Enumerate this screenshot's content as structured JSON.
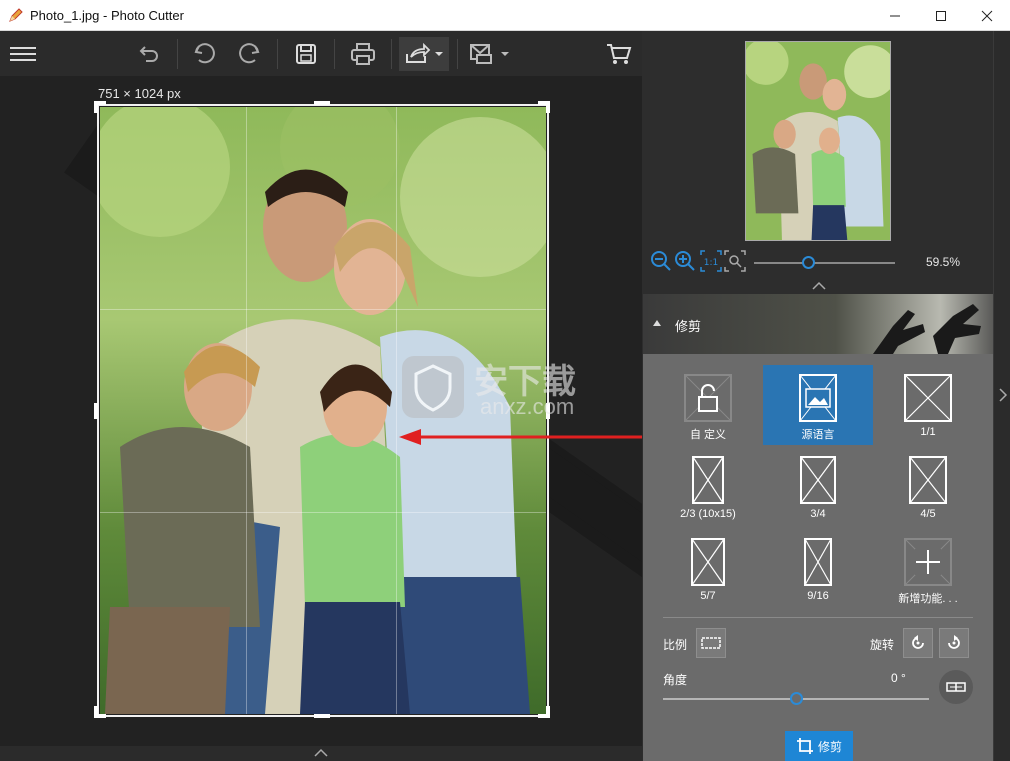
{
  "window": {
    "title": "Photo_1.jpg - Photo Cutter",
    "minimize_glyph": "—",
    "maximize_glyph": "☐",
    "close_glyph": "✕"
  },
  "toolbar": {
    "items": [
      "menu-icon",
      "undo-arrow-icon",
      "undo-icon",
      "redo-icon",
      "save-icon",
      "print-icon",
      "share-icon",
      "send-icon",
      "cart-icon"
    ]
  },
  "canvas": {
    "dimensions_label": "751 × 1024 px"
  },
  "zoom": {
    "value": "59.5%",
    "level": 0.38
  },
  "section": {
    "title": "修剪"
  },
  "crop": {
    "ratios": [
      {
        "label": "自 定义",
        "selected": false
      },
      {
        "label": "源语言",
        "selected": true
      },
      {
        "label": "1/1",
        "selected": false
      },
      {
        "label": "2/3 (10x15)",
        "selected": false
      },
      {
        "label": "3/4",
        "selected": false
      },
      {
        "label": "4/5",
        "selected": false
      },
      {
        "label": "5/7",
        "selected": false
      },
      {
        "label": "9/16",
        "selected": false
      },
      {
        "label": "新增功能. . .",
        "selected": false
      }
    ],
    "ratio_label": "比例",
    "rotate_label": "旋转",
    "angle_label": "角度",
    "angle_value": "0 °",
    "angle_level": 0.5,
    "action_label": "修剪"
  },
  "watermark": {
    "text": "安下载",
    "url": "anxz.com"
  },
  "colors": {
    "accent": "#2a75b3",
    "action": "#1e86d5",
    "arrow": "#e02020"
  }
}
